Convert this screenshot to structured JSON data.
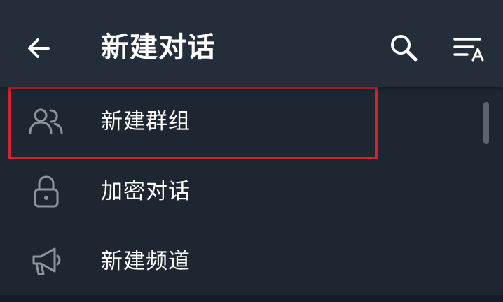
{
  "header": {
    "title": "新建对话",
    "icons": {
      "back": "arrow-left-icon",
      "search": "search-icon",
      "sort": "sort-alphabet-icon"
    }
  },
  "menu": {
    "items": [
      {
        "label": "新建群组",
        "icon": "users-icon"
      },
      {
        "label": "加密对话",
        "icon": "lock-icon"
      },
      {
        "label": "新建频道",
        "icon": "megaphone-icon"
      }
    ]
  },
  "colors": {
    "header_bg": "#242d3a",
    "list_bg": "#1e2632",
    "icon_color": "#8d949c",
    "text_color": "#ffffff",
    "highlight_border": "#d5222b"
  }
}
